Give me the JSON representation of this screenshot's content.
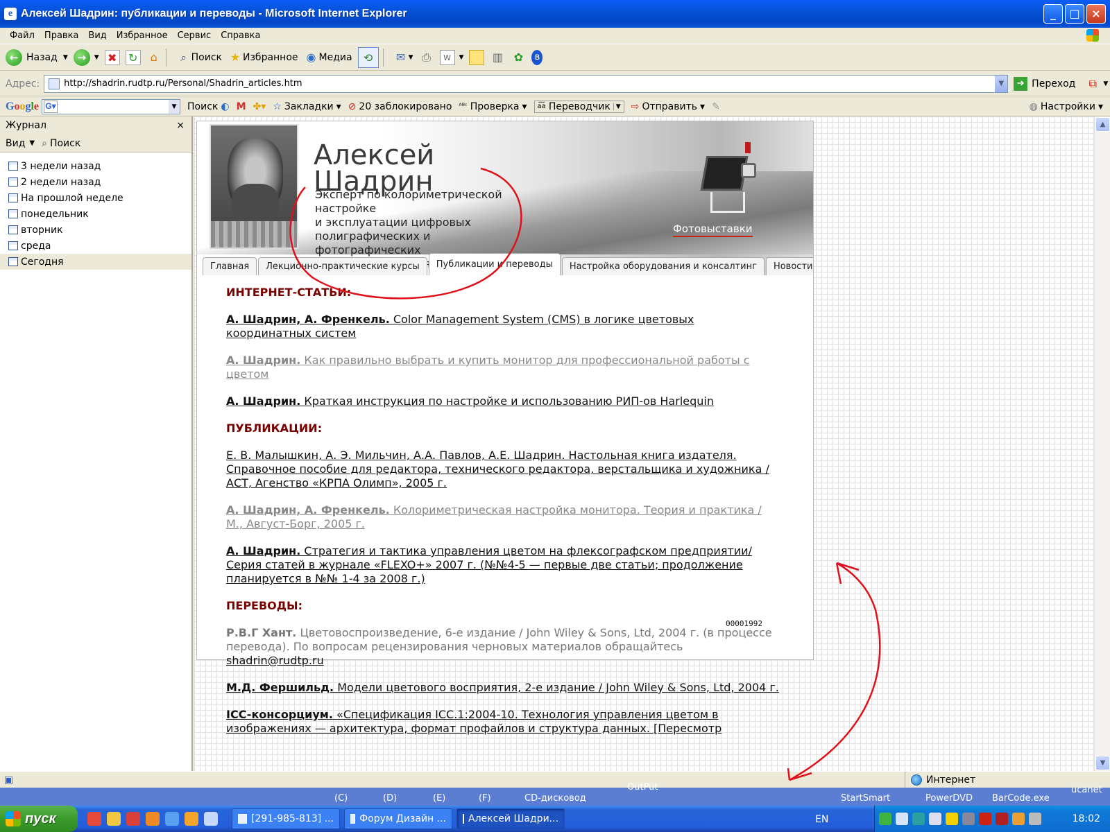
{
  "window": {
    "title": "Алексей Шадрин: публикации и переводы - Microsoft Internet Explorer"
  },
  "menu": [
    "Файл",
    "Правка",
    "Вид",
    "Избранное",
    "Сервис",
    "Справка"
  ],
  "toolbar": {
    "back": "Назад",
    "search": "Поиск",
    "favorites": "Избранное",
    "media": "Медиа"
  },
  "address": {
    "label": "Адрес:",
    "url": "http://shadrin.rudtp.ru/Personal/Shadrin_articles.htm",
    "go": "Переход"
  },
  "googlebar": {
    "logo": "Google",
    "search": "Поиск",
    "bookmarks": "Закладки",
    "blocked": "20 заблокировано",
    "check": "Проверка",
    "translator": "Переводчик",
    "send": "Отправить",
    "settings": "Настройки"
  },
  "sidebar": {
    "title": "Журнал",
    "view": "Вид",
    "search": "Поиск",
    "items": [
      "3 недели назад",
      "2 недели назад",
      "На прошлой неделе",
      "понедельник",
      "вторник",
      "среда",
      "Сегодня"
    ],
    "selected_index": 6
  },
  "site": {
    "name_line1": "Алексей",
    "name_line2": "Шадрин",
    "subtitle": "Эксперт по колориметрической настройке\nи эксплуатации цифровых полиграфических и фотографических цветовоспроизводящих систем,\nфотограф-пейзажист",
    "photo_link": "Фотовыставки",
    "tabs": [
      "Главная",
      "Лекционно-практические курсы",
      "Публикации и переводы",
      "Настройка оборудования и консалтинг",
      "Новости"
    ],
    "active_tab": 2,
    "counter": "00001992",
    "sections": {
      "internet": "ИНТЕРНЕТ-СТАТЬИ:",
      "publications": "ПУБЛИКАЦИИ:",
      "translations": "ПЕРЕВОДЫ:"
    },
    "internet_entries": [
      {
        "author": "А. Шадрин, А. Френкель.",
        "text": " Color Management System (CMS) в логике цветовых координатных систем",
        "gray": false
      },
      {
        "author": "А. Шадрин.",
        "text": " Как правильно выбрать и купить монитор для профессиональной работы с цветом",
        "gray": true
      },
      {
        "author": "А. Шадрин.",
        "text": " Краткая инструкция по настройке и использованию РИП-ов Harlequin",
        "gray": false
      }
    ],
    "publication_entries": [
      {
        "author": "",
        "text": "Е. В. Малышкин, А. Э. Мильчин, А.А. Павлов, А.Е. Шадрин. Настольная книга издателя. Справочное пособие для редактора, технического редактора, верстальщика и художника / АСТ, Агенство «КРПА Олимп», 2005 г.",
        "gray": false
      },
      {
        "author": "А. Шадрин, А. Френкель.",
        "text": " Колориметрическая настройка монитора. Теория и практика / М., Август-Борг, 2005 г.",
        "gray": true
      },
      {
        "author": "А. Шадрин.",
        "text": " Стратегия и тактика управления цветом на флексографском предприятии/ Серия статей в журнале «FLEXO+» 2007 г. (№№4-5 — первые две статьи; продолжение планируется в №№ 1-4 за 2008 г.)",
        "gray": false
      }
    ],
    "translation_1": {
      "author": "Р.В.Г Хант.",
      "text": " Цветовоспроизведение, 6-е издание / John Wiley & Sons, Ltd, 2004 г. (в процессе перевода). По вопросам рецензирования черновых материалов обращайтесь ",
      "email": "shadrin@rudtp.ru"
    },
    "translation_2": {
      "author": "М.Д. Фершильд.",
      "text": " Модели цветового восприятия, 2-е издание / John Wiley & Sons, Ltd, 2004 г."
    },
    "translation_3": {
      "author": "ICC-консорциум.",
      "text": " «Спецификация ICC.1:2004-10. Технология управления цветом в изображениях — архитектура, формат профайлов и структура данных. [Пересмотр"
    }
  },
  "status": {
    "zone": "Интернет"
  },
  "desktop_labels": [
    "(C)",
    "(D)",
    "(E)",
    "(F)",
    "CD-дисковод",
    "OutPut",
    "StartSmart",
    "PowerDVD",
    "BarCode.exe",
    "ucanet"
  ],
  "taskbar": {
    "start": "пуск",
    "tasks": [
      "[291-985-813] ...",
      "Форум Дизайн ...",
      "Алексей Шадри..."
    ],
    "active_task": 2,
    "lang": "EN",
    "clock": "18:02"
  },
  "colors": {
    "section": "#7a0000",
    "annotation": "#e0101a",
    "titlebar": "#0651d8"
  }
}
